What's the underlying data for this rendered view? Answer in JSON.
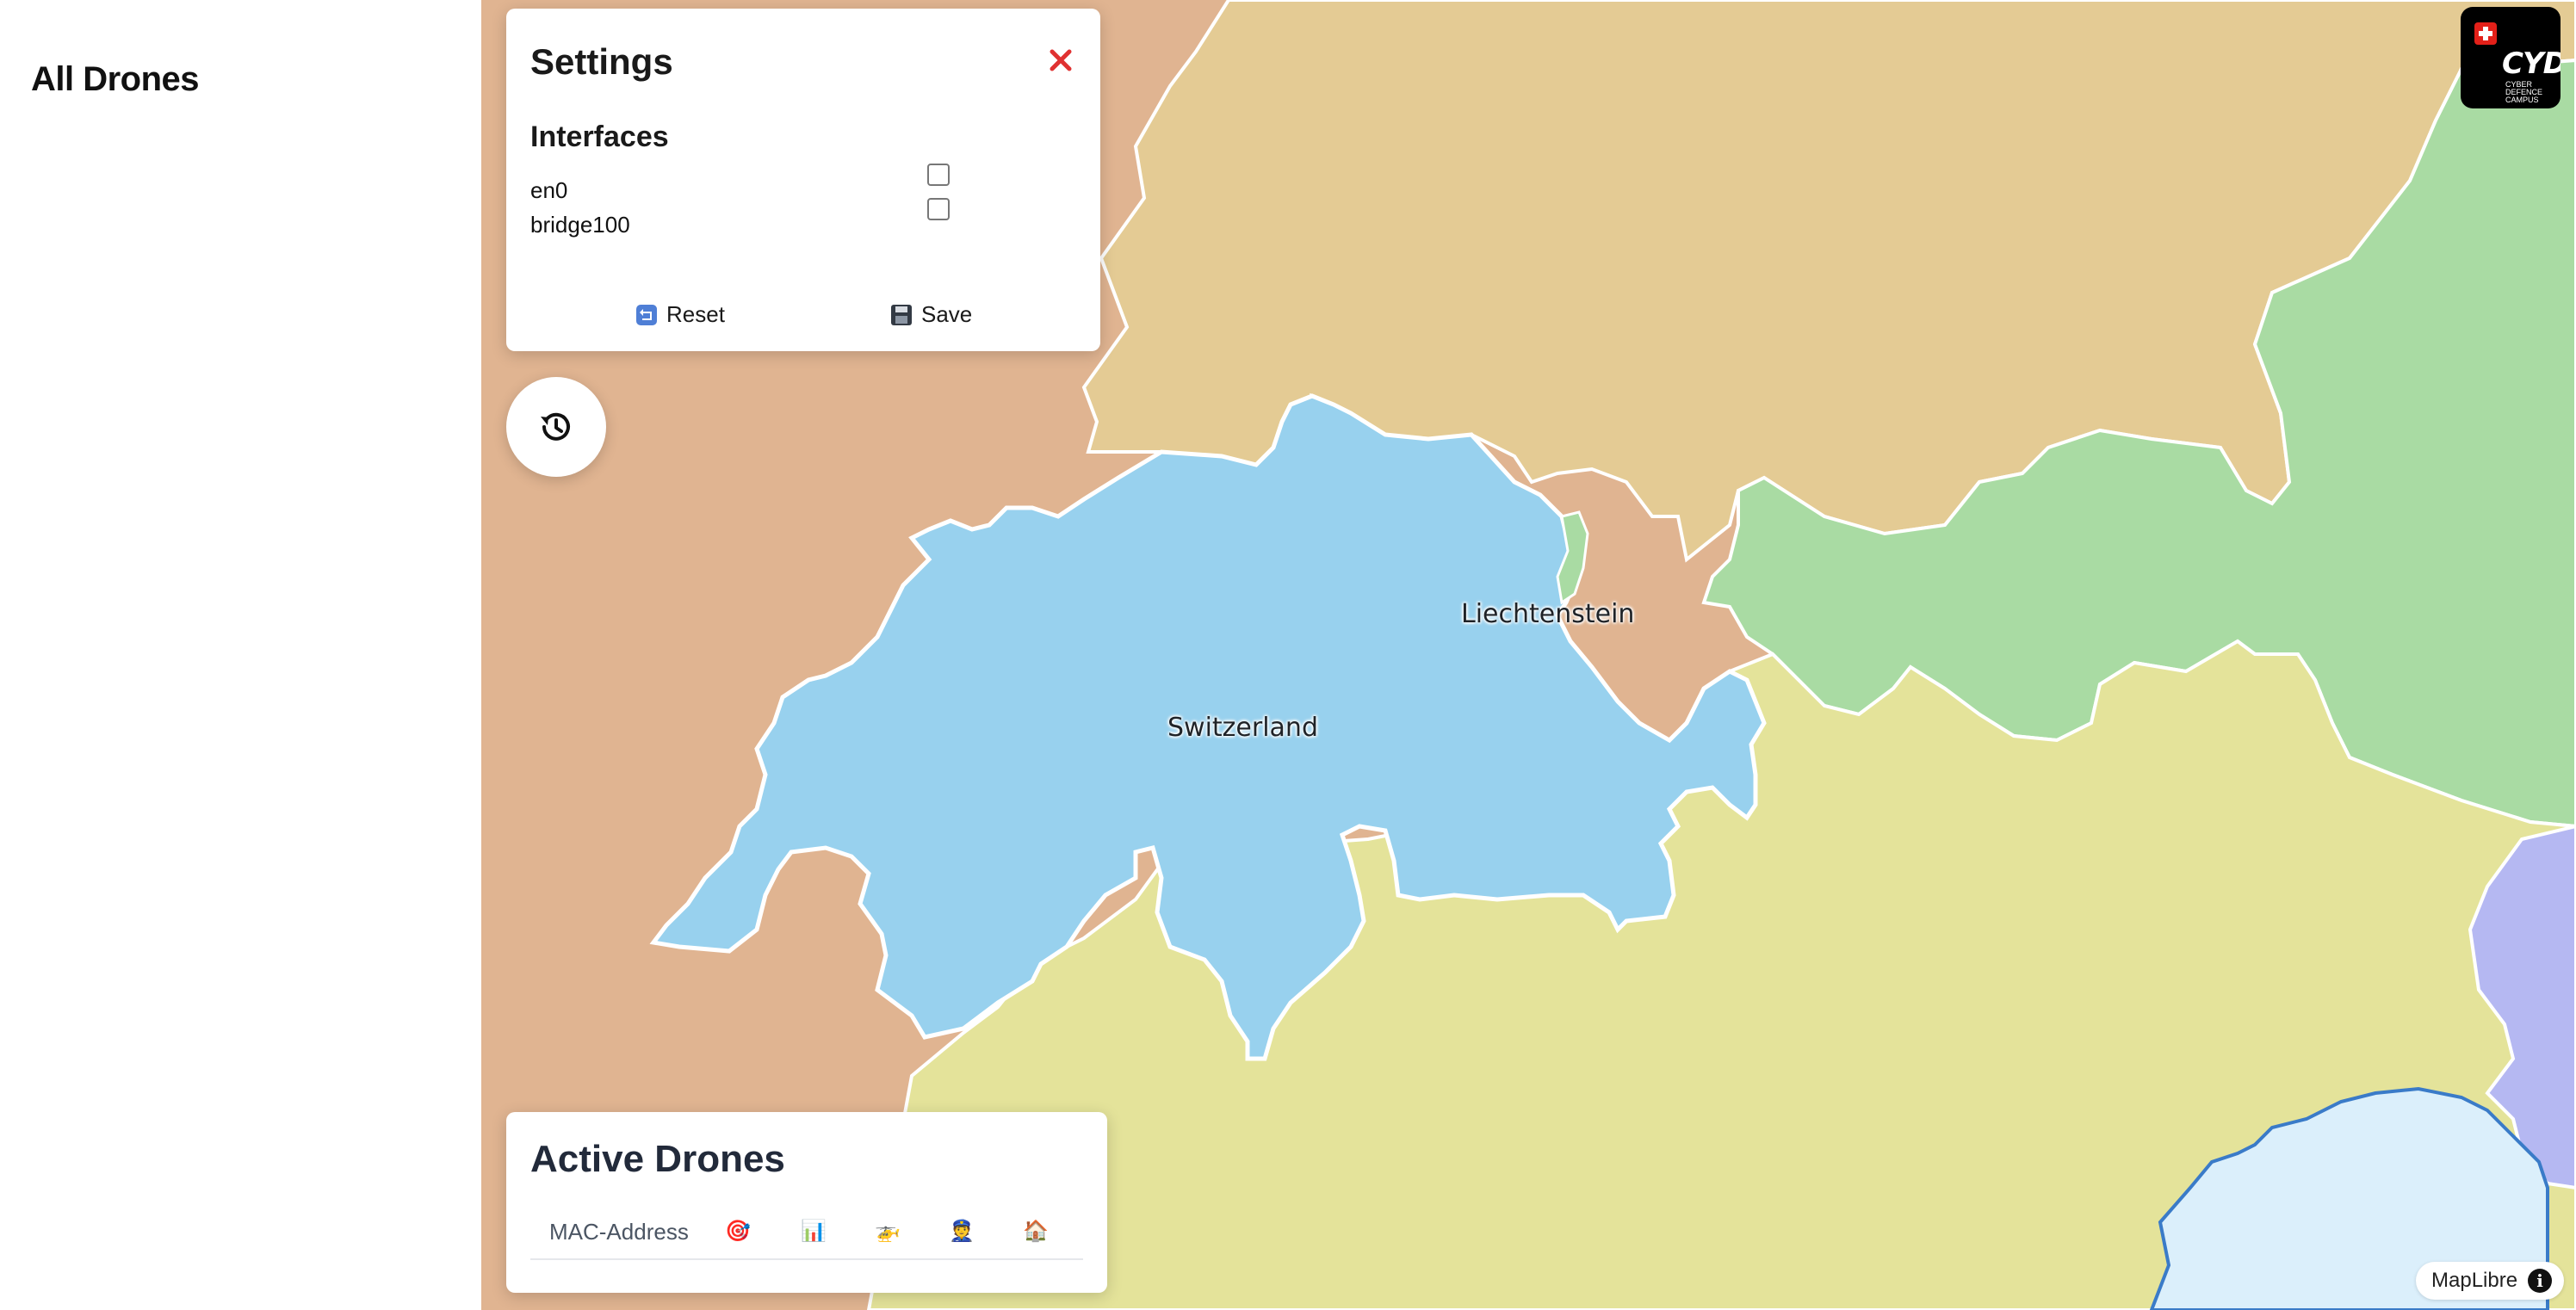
{
  "sidebar": {
    "title": "All Drones"
  },
  "settings": {
    "title": "Settings",
    "section_title": "Interfaces",
    "interfaces": [
      {
        "name": "en0",
        "checked": false
      },
      {
        "name": "bridge100",
        "checked": false
      }
    ],
    "reset_label": "Reset",
    "save_label": "Save"
  },
  "history_button": {
    "icon": "history-icon"
  },
  "active_drones": {
    "title": "Active Drones",
    "columns": [
      "MAC-Address",
      "🎯",
      "📊",
      "🚁",
      "👮",
      "🏠"
    ]
  },
  "map": {
    "labels": {
      "switzerland": "Switzerland",
      "liechtenstein": "Liechtenstein"
    },
    "attribution": "MapLibre",
    "info_glyph": "i",
    "colors": {
      "france": "#e0b491",
      "germany": "#e4cb94",
      "austria": "#a9dba3",
      "switzerland": "#98d1ee",
      "italy": "#e4e39a",
      "slovenia": "#b5b8f2",
      "adriatic": "#dbeffb",
      "border": "#ffffff"
    }
  },
  "logo": {
    "text": "CYD",
    "subtext": "CYBER DEFENCE CAMPUS"
  }
}
